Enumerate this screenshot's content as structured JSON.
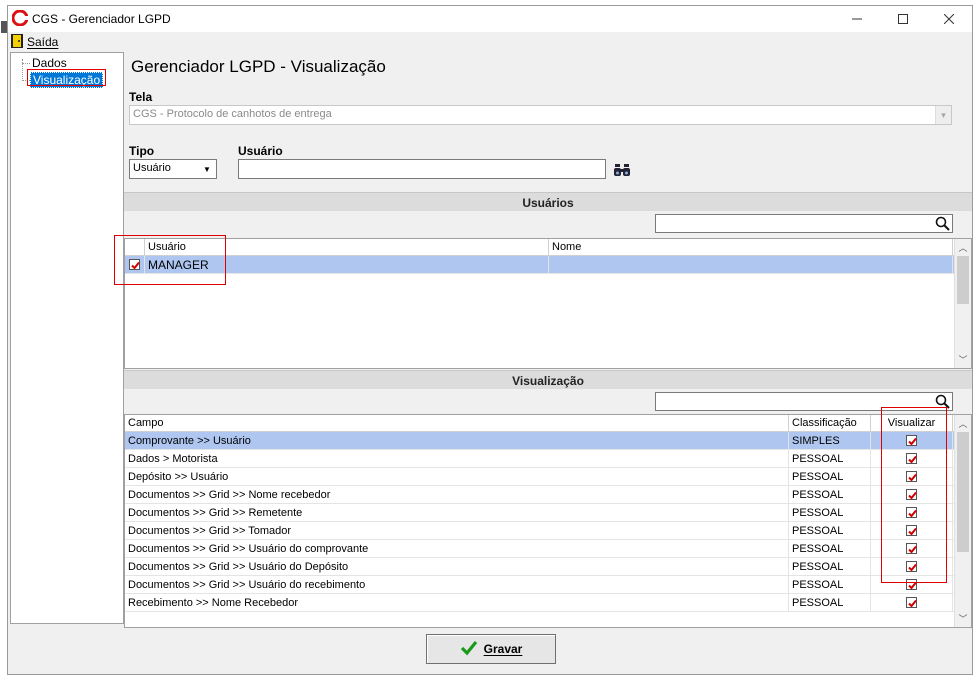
{
  "window": {
    "title": "CGS - Gerenciador LGPD"
  },
  "menu": {
    "exit_label": "Saída"
  },
  "tree": {
    "items": [
      "Dados",
      "Visualização"
    ]
  },
  "page": {
    "title": "Gerenciador LGPD - Visualização",
    "tela_label": "Tela",
    "tela_value": "CGS - Protocolo de canhotos de entrega",
    "tipo_label": "Tipo",
    "tipo_value": "Usuário",
    "usuario_label": "Usuário",
    "usuario_value": ""
  },
  "users_section": {
    "header": "Usuários",
    "search_value": "",
    "columns": [
      "Usuário",
      "Nome"
    ],
    "rows": [
      {
        "checked": true,
        "usuario": "MANAGER",
        "nome": ""
      }
    ]
  },
  "vis_section": {
    "header": "Visualização",
    "search_value": "",
    "columns": [
      "Campo",
      "Classificação",
      "Visualizar"
    ],
    "rows": [
      {
        "campo": "Comprovante >> Usuário",
        "classificacao": "SIMPLES",
        "visualizar": true
      },
      {
        "campo": "Dados > Motorista",
        "classificacao": "PESSOAL",
        "visualizar": true
      },
      {
        "campo": "Depósito >> Usuário",
        "classificacao": "PESSOAL",
        "visualizar": true
      },
      {
        "campo": "Documentos >> Grid >> Nome recebedor",
        "classificacao": "PESSOAL",
        "visualizar": true
      },
      {
        "campo": "Documentos >> Grid >> Remetente",
        "classificacao": "PESSOAL",
        "visualizar": true
      },
      {
        "campo": "Documentos >> Grid >> Tomador",
        "classificacao": "PESSOAL",
        "visualizar": true
      },
      {
        "campo": "Documentos >> Grid >> Usuário do comprovante",
        "classificacao": "PESSOAL",
        "visualizar": true
      },
      {
        "campo": "Documentos >> Grid >> Usuário do Depósito",
        "classificacao": "PESSOAL",
        "visualizar": true
      },
      {
        "campo": "Documentos >> Grid >> Usuário do recebimento",
        "classificacao": "PESSOAL",
        "visualizar": true
      },
      {
        "campo": "Recebimento >> Nome Recebedor",
        "classificacao": "PESSOAL",
        "visualizar": true
      }
    ]
  },
  "footer": {
    "save_label": "Gravar"
  },
  "colors": {
    "selection": "#aec6f0",
    "tree_selection": "#0078d7",
    "highlight_box": "#e00000",
    "check": "#d00000"
  }
}
